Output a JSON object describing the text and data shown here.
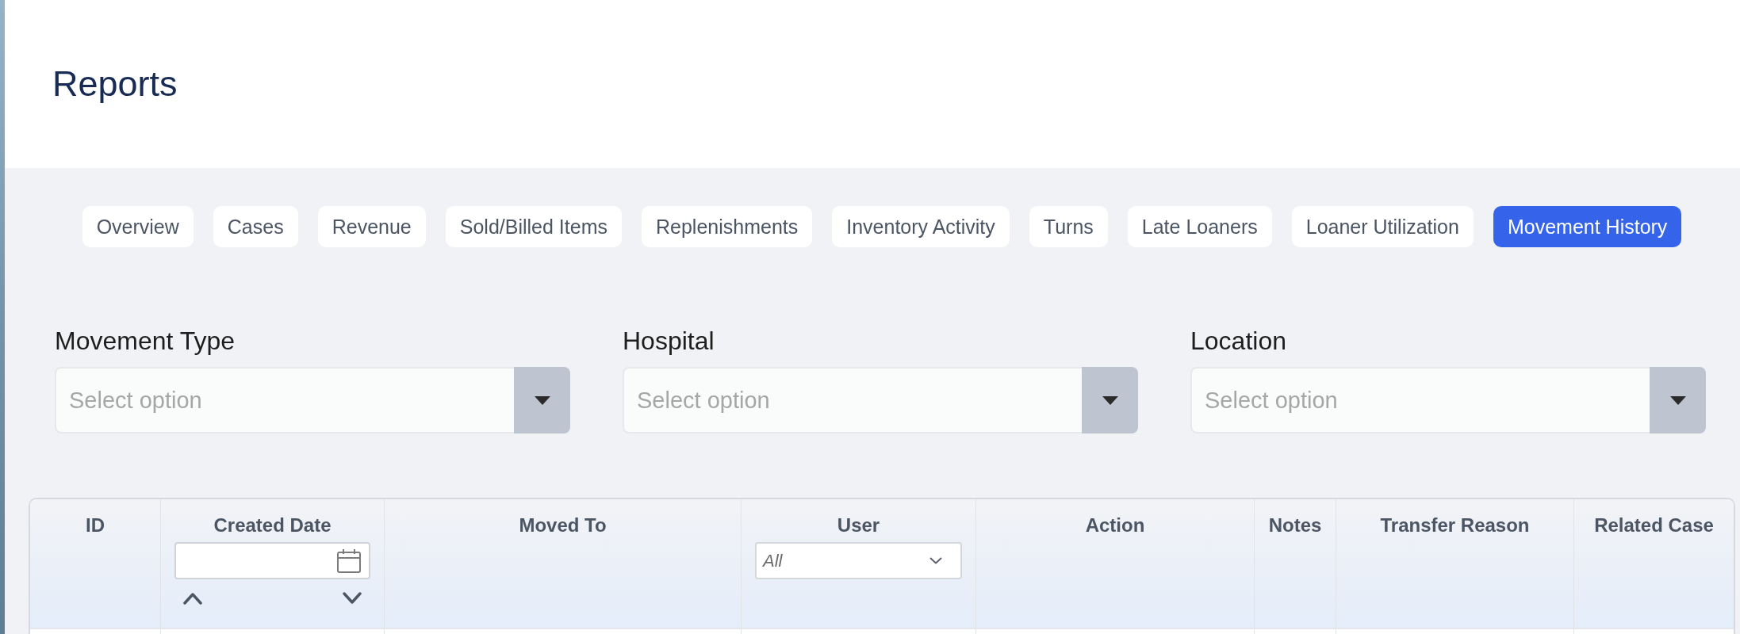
{
  "page": {
    "title": "Reports"
  },
  "tabs": [
    {
      "label": "Overview",
      "selected": false
    },
    {
      "label": "Cases",
      "selected": false
    },
    {
      "label": "Revenue",
      "selected": false
    },
    {
      "label": "Sold/Billed Items",
      "selected": false
    },
    {
      "label": "Replenishments",
      "selected": false
    },
    {
      "label": "Inventory Activity",
      "selected": false
    },
    {
      "label": "Turns",
      "selected": false
    },
    {
      "label": "Late Loaners",
      "selected": false
    },
    {
      "label": "Loaner Utilization",
      "selected": false
    },
    {
      "label": "Movement History",
      "selected": true
    }
  ],
  "filters": [
    {
      "label": "Movement Type",
      "placeholder": "Select option"
    },
    {
      "label": "Hospital",
      "placeholder": "Select option"
    },
    {
      "label": "Location",
      "placeholder": "Select option"
    }
  ],
  "table": {
    "columns": [
      {
        "label": "ID",
        "kind": "text"
      },
      {
        "label": "Created Date",
        "kind": "date"
      },
      {
        "label": "Moved To",
        "kind": "text"
      },
      {
        "label": "User",
        "kind": "select",
        "value": "All"
      },
      {
        "label": "Action",
        "kind": "text"
      },
      {
        "label": "Notes",
        "kind": "text"
      },
      {
        "label": "Transfer Reason",
        "kind": "text"
      },
      {
        "label": "Related Case",
        "kind": "text"
      }
    ]
  }
}
